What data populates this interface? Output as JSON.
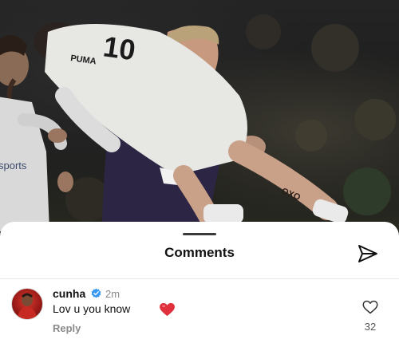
{
  "photo": {
    "jersey_number": "10",
    "jersey_text": "PUMA",
    "sponsor_text": "sports",
    "tattoo_text": "OXO"
  },
  "sheet": {
    "title": "Comments"
  },
  "comments": [
    {
      "username": "cunha",
      "verified": true,
      "time": "2m",
      "text": "Lov u you know",
      "emoji": "red-heart",
      "reply_label": "Reply",
      "like_count": "32"
    }
  ],
  "colors": {
    "verified_blue": "#3897f0",
    "heart_red": "#e0303c",
    "background": "#ffffff"
  },
  "icons": {
    "send": "send-icon",
    "like": "heart-outline-icon",
    "verified": "verified-badge-icon"
  }
}
